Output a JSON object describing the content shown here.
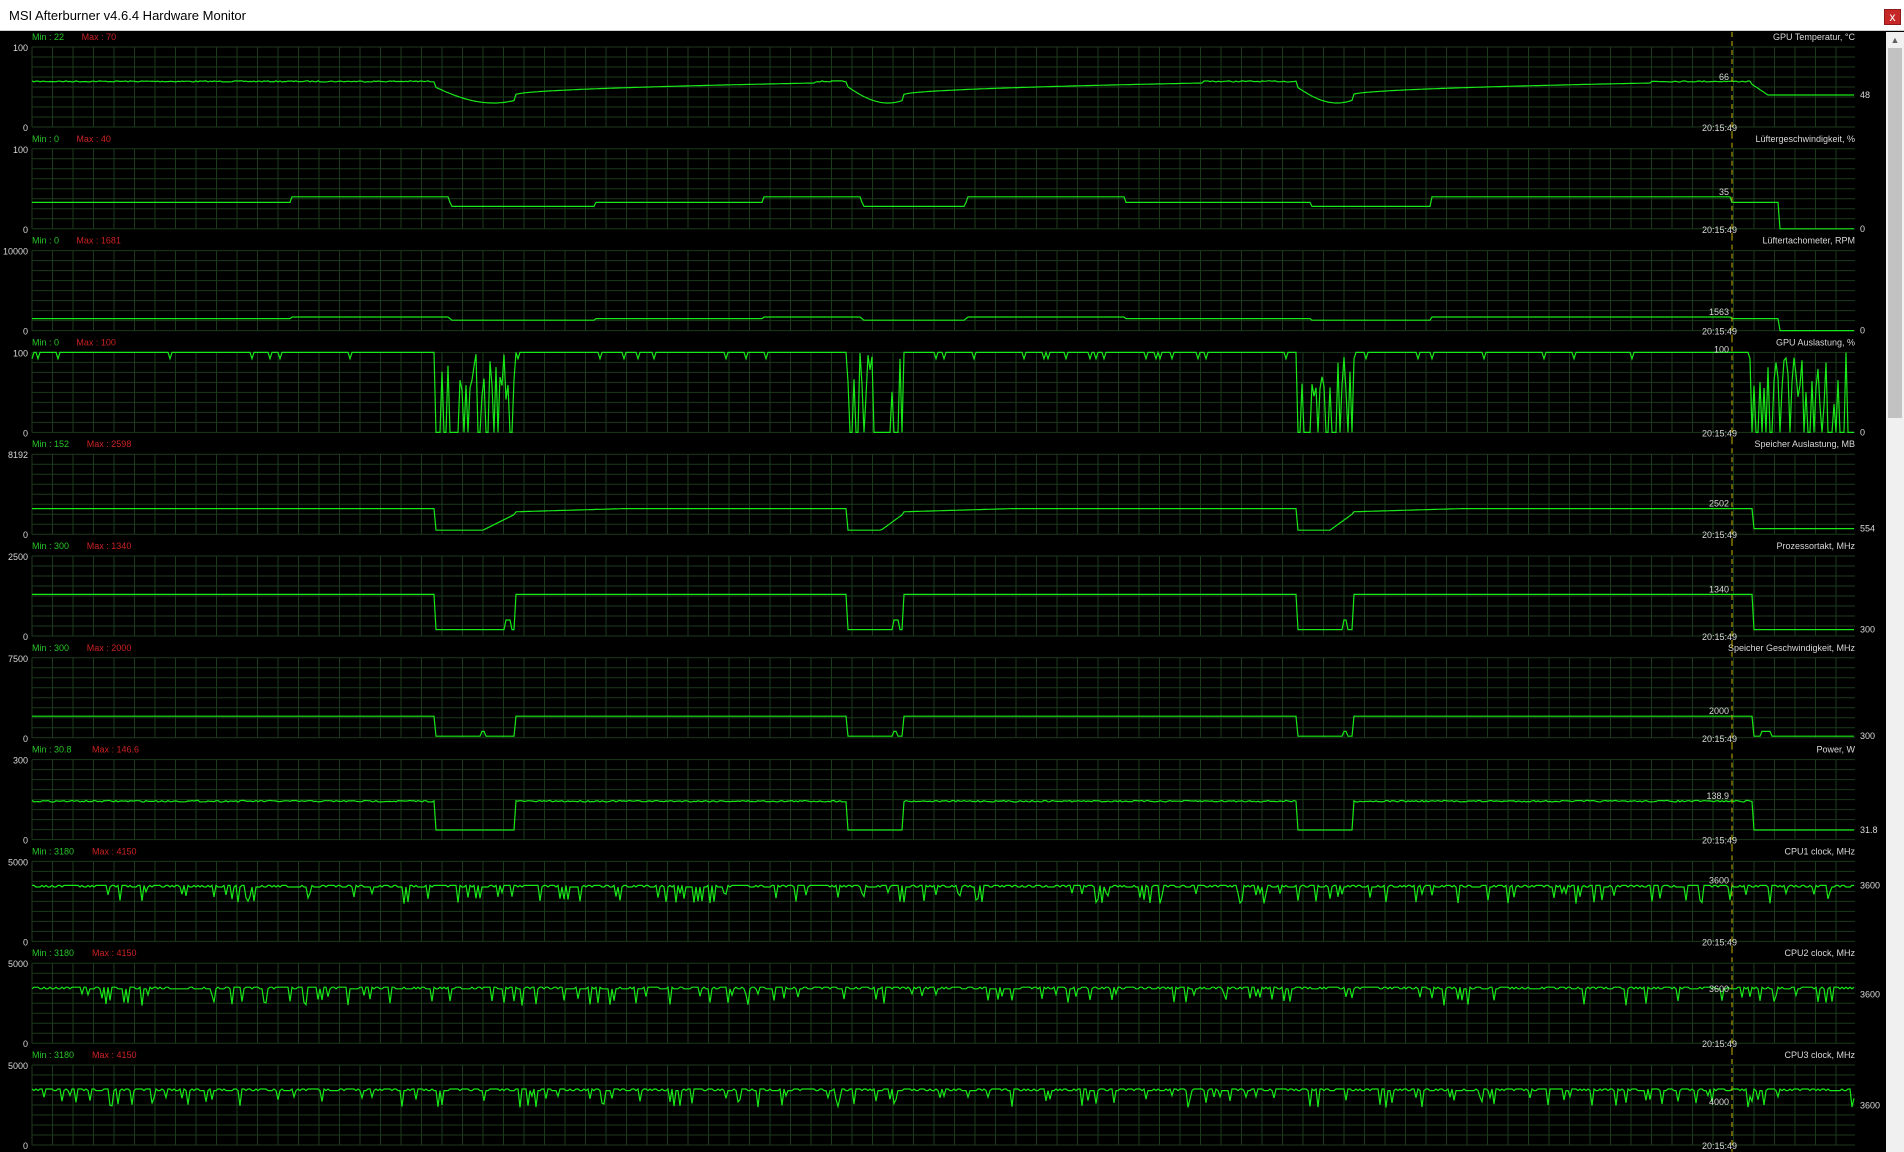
{
  "window": {
    "title": "MSI Afterburner v4.6.4 Hardware Monitor",
    "close_label": "x"
  },
  "colors": {
    "background": "#000000",
    "grid": "#1b3a1b",
    "series": "#18e818",
    "min_label": "#27c427",
    "max_label": "#cc2222",
    "text": "#d8d8d8",
    "cursor": "#c8b400"
  },
  "cursor_time": "20:15:49",
  "graphs": [
    {
      "name": "GPU Temperatur, °C",
      "min_label": "Min : 22",
      "max_label": "Max : 70",
      "y_top": "100",
      "y_bottom": "0",
      "cursor_value": "66",
      "current_value": "48",
      "profile": "temp"
    },
    {
      "name": "Lüftergeschwindigkeit, %",
      "min_label": "Min : 0",
      "max_label": "Max : 40",
      "y_top": "100",
      "y_bottom": "0",
      "cursor_value": "35",
      "current_value": "0",
      "profile": "fan"
    },
    {
      "name": "Lüftertachometer, RPM",
      "min_label": "Min : 0",
      "max_label": "Max : 1681",
      "y_top": "10000",
      "y_bottom": "0",
      "cursor_value": "1563",
      "current_value": "0",
      "profile": "rpm"
    },
    {
      "name": "GPU Auslastung, %",
      "min_label": "Min : 0",
      "max_label": "Max : 100",
      "y_top": "100",
      "y_bottom": "0",
      "cursor_value": "100",
      "current_value": "0",
      "profile": "usage"
    },
    {
      "name": "Speicher Auslastung, MB",
      "min_label": "Min : 152",
      "max_label": "Max : 2598",
      "y_top": "8192",
      "y_bottom": "0",
      "cursor_value": "2502",
      "current_value": "554",
      "profile": "mem"
    },
    {
      "name": "Prozessortakt, MHz",
      "min_label": "Min : 300",
      "max_label": "Max : 1340",
      "y_top": "2500",
      "y_bottom": "0",
      "cursor_value": "1340",
      "current_value": "300",
      "profile": "coreclk"
    },
    {
      "name": "Speicher Geschwindigkeit, MHz",
      "min_label": "Min : 300",
      "max_label": "Max : 2000",
      "y_top": "7500",
      "y_bottom": "0",
      "cursor_value": "2000",
      "current_value": "300",
      "profile": "memclk"
    },
    {
      "name": "Power, W",
      "min_label": "Min : 30.8",
      "max_label": "Max : 146.6",
      "y_top": "300",
      "y_bottom": "0",
      "cursor_value": "138.9",
      "current_value": "31.8",
      "profile": "power"
    },
    {
      "name": "CPU1 clock, MHz",
      "min_label": "Min : 3180",
      "max_label": "Max : 4150",
      "y_top": "5000",
      "y_bottom": "0",
      "cursor_value": "3600",
      "current_value": "3600",
      "profile": "cpu"
    },
    {
      "name": "CPU2 clock, MHz",
      "min_label": "Min : 3180",
      "max_label": "Max : 4150",
      "y_top": "5000",
      "y_bottom": "0",
      "cursor_value": "3600",
      "current_value": "3600",
      "profile": "cpu"
    },
    {
      "name": "CPU3 clock, MHz",
      "min_label": "Min : 3180",
      "max_label": "Max : 4150",
      "y_top": "5000",
      "y_bottom": "0",
      "cursor_value": "4000",
      "current_value": "3600",
      "profile": "cpu"
    }
  ]
}
